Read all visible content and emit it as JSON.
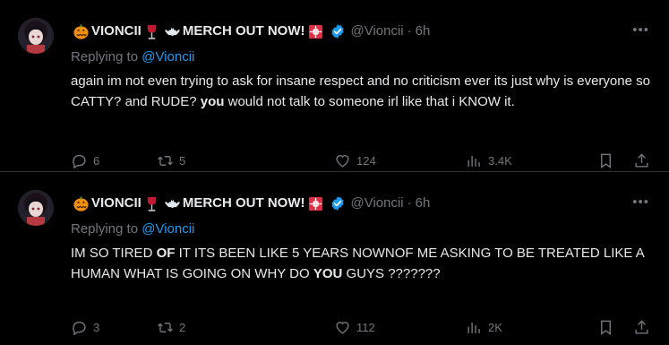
{
  "tweets": [
    {
      "display_name": "VIONCII",
      "merch_text": "MERCH OUT NOW!",
      "handle": "@Vioncii",
      "time": "6h",
      "replying_prefix": "Replying to",
      "replying_to": "@Vioncii",
      "text_1": "again im not even trying to ask for insane respect and no criticism ever its just why is everyone so CATTY? and RUDE? ",
      "text_bold": "you",
      "text_2": " would not talk to someone irl like that i KNOW it.",
      "replies": "6",
      "retweets": "5",
      "likes": "124",
      "views": "3.4K"
    },
    {
      "display_name": "VIONCII",
      "merch_text": "MERCH OUT NOW!",
      "handle": "@Vioncii",
      "time": "6h",
      "replying_prefix": "Replying to",
      "replying_to": "@Vioncii",
      "text_1": "IM SO TIRED ",
      "text_bold_1": "OF",
      "text_2": " IT ITS BEEN LIKE 5 YEARS NOWNOF ME ASKING TO BE TREATED LIKE A HUMAN WHAT IS GOING ON WHY DO ",
      "text_bold_2": "YOU",
      "text_3": " GUYS ???????",
      "replies": "3",
      "retweets": "2",
      "likes": "112",
      "views": "2K"
    }
  ],
  "colors": {
    "background": "#000000",
    "text": "#e7e9ea",
    "muted": "#71767b",
    "link": "#1d9bf0",
    "divider": "#2f3336"
  },
  "icons": {
    "emoji_1": "pumpkin-emoji",
    "emoji_2": "wine-glass-emoji",
    "emoji_3": "bat-emoji",
    "emoji_4": "siren-emoji",
    "badge": "verified-badge-icon",
    "more": "more-options-icon",
    "reply": "reply-icon",
    "retweet": "retweet-icon",
    "like": "heart-icon",
    "views": "views-icon",
    "bookmark": "bookmark-icon",
    "share": "share-icon"
  }
}
